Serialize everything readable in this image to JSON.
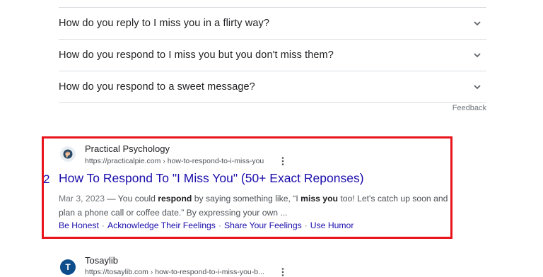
{
  "people_also_ask": {
    "questions": [
      "How do you reply to I miss you in a flirty way?",
      "How do you respond to I miss you but you don't miss them?",
      "How do you respond to a sweet message?"
    ],
    "feedback_label": "Feedback"
  },
  "highlight_color": "#e8141c",
  "result1": {
    "index_label": "2",
    "site_name": "Practical Psychology",
    "url": "https://practicalpie.com › how-to-respond-to-i-miss-you",
    "title": "How To Respond To \"I Miss You\" (50+ Exact Reponses)",
    "date": "Mar 3, 2023",
    "snippet_parts": [
      " — You could ",
      "respond",
      " by saying something like, “I ",
      "miss you",
      " too! Let's catch up soon and plan a phone call or coffee date.” By expressing your own ..."
    ],
    "sublinks": [
      "Be Honest",
      "Acknowledge Their Feelings",
      "Share Your Feelings",
      "Use Humor"
    ]
  },
  "result2": {
    "site_name": "Tosaylib",
    "favicon_letter": "T",
    "url": "https://tosaylib.com › how-to-respond-to-i-miss-you-b..."
  }
}
